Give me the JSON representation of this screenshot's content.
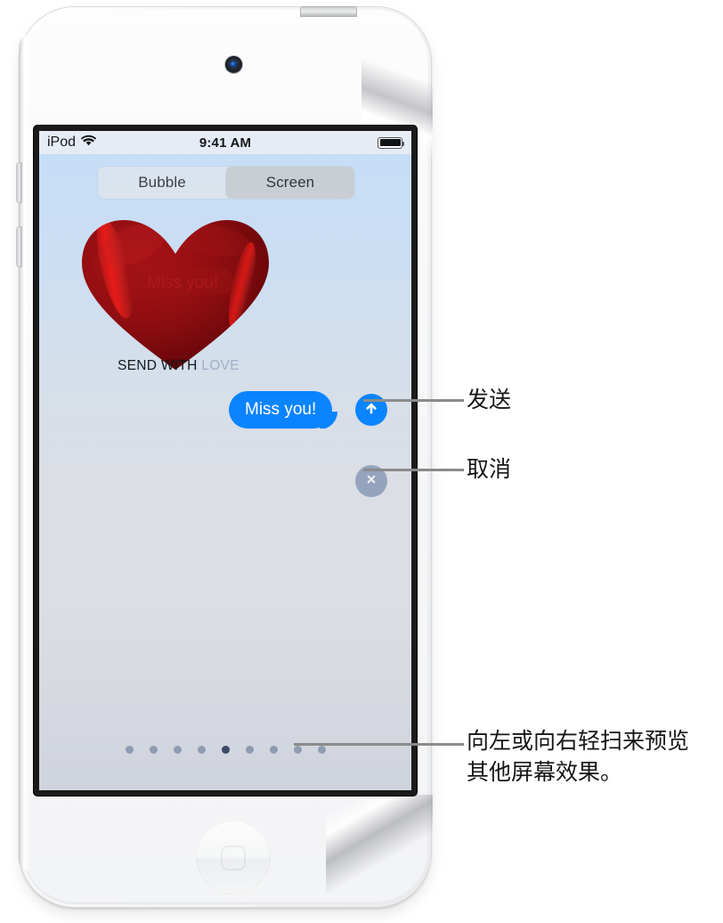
{
  "device": {
    "name": "ipod-touch",
    "camera": "front-camera",
    "home_button": "home-button"
  },
  "status_bar": {
    "carrier": "iPod",
    "wifi_icon": "wifi-icon",
    "time": "9:41 AM",
    "battery_icon": "battery-full-icon"
  },
  "segmented_control": {
    "options": [
      {
        "label": "Bubble",
        "selected": false
      },
      {
        "label": "Screen",
        "selected": true
      }
    ]
  },
  "effect_preview": {
    "balloon_icon": "heart-balloon",
    "caption_primary": "SEND WITH ",
    "caption_secondary": "LOVE"
  },
  "message": {
    "bubble_text": "Miss you!",
    "bubble_color": "#0b84ff"
  },
  "actions": {
    "send": {
      "icon": "arrow-up-icon",
      "color": "#0b84ff"
    },
    "cancel": {
      "icon": "close-x-icon",
      "color": "#94a4bd"
    }
  },
  "page_dots": {
    "count": 9,
    "active_index": 4
  },
  "callouts": [
    {
      "key": "send",
      "label": "发送"
    },
    {
      "key": "cancel",
      "label": "取消"
    },
    {
      "key": "swipe",
      "label": "向左或向右轻扫来预览\n其他屏幕效果。"
    }
  ]
}
